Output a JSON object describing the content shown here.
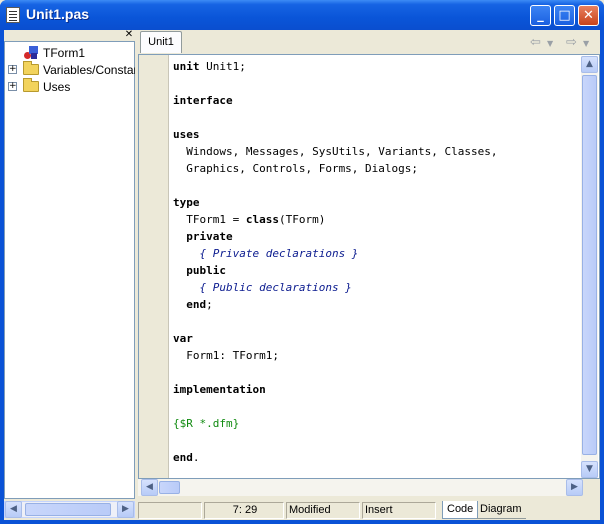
{
  "window": {
    "title": "Unit1.pas"
  },
  "tree": {
    "close_glyph": "✕",
    "nodes": [
      {
        "label": "TForm1",
        "icon": "form-icon",
        "expander": ""
      },
      {
        "label": "Variables/Constan",
        "icon": "folder-icon",
        "expander": "+"
      },
      {
        "label": "Uses",
        "icon": "folder-icon",
        "expander": "+"
      }
    ]
  },
  "editor": {
    "tab_label": "Unit1",
    "code_lines": [
      [
        {
          "t": "unit",
          "c": "kw"
        },
        {
          "t": " Unit1;",
          "c": ""
        }
      ],
      [],
      [
        {
          "t": "interface",
          "c": "kw"
        }
      ],
      [],
      [
        {
          "t": "uses",
          "c": "kw"
        }
      ],
      [
        {
          "t": "  Windows, Messages, SysUtils, Variants, Classes,",
          "c": ""
        }
      ],
      [
        {
          "t": "  Graphics, Controls, Forms, Dialogs;",
          "c": ""
        }
      ],
      [],
      [
        {
          "t": "type",
          "c": "kw"
        }
      ],
      [
        {
          "t": "  TForm1 = ",
          "c": ""
        },
        {
          "t": "class",
          "c": "kw"
        },
        {
          "t": "(TForm)",
          "c": ""
        }
      ],
      [
        {
          "t": "  ",
          "c": ""
        },
        {
          "t": "private",
          "c": "kw"
        }
      ],
      [
        {
          "t": "    { Private declarations }",
          "c": "cm"
        }
      ],
      [
        {
          "t": "  ",
          "c": ""
        },
        {
          "t": "public",
          "c": "kw"
        }
      ],
      [
        {
          "t": "    { Public declarations }",
          "c": "cm"
        }
      ],
      [
        {
          "t": "  ",
          "c": ""
        },
        {
          "t": "end",
          "c": "kw"
        },
        {
          "t": ";",
          "c": ""
        }
      ],
      [],
      [
        {
          "t": "var",
          "c": "kw"
        }
      ],
      [
        {
          "t": "  Form1: TForm1;",
          "c": ""
        }
      ],
      [],
      [
        {
          "t": "implementation",
          "c": "kw"
        }
      ],
      [],
      [
        {
          "t": "{$R *.dfm}",
          "c": "dir"
        }
      ],
      [],
      [
        {
          "t": "end",
          "c": "kw"
        },
        {
          "t": ".",
          "c": ""
        }
      ]
    ]
  },
  "status": {
    "position": "7:  29",
    "modified": "Modified",
    "mode": "Insert",
    "tabs": [
      "Code",
      "Diagram"
    ]
  }
}
